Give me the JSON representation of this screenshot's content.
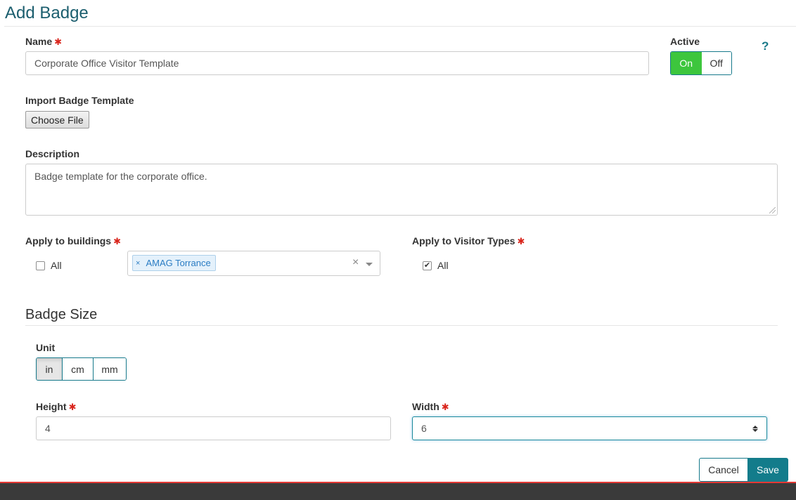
{
  "page": {
    "title": "Add Badge"
  },
  "name_field": {
    "label": "Name",
    "required_mark": "✱",
    "value": "Corporate Office Visitor Template"
  },
  "active": {
    "label": "Active",
    "on_label": "On",
    "off_label": "Off",
    "selected": "On"
  },
  "help": {
    "glyph": "?"
  },
  "import_template": {
    "label": "Import Badge Template",
    "button_label": "Choose File"
  },
  "description": {
    "label": "Description",
    "value": "Badge template for the corporate office."
  },
  "buildings": {
    "label": "Apply to buildings",
    "required_mark": "✱",
    "all_label": "All",
    "all_checked": false,
    "selected_tags": [
      {
        "remove": "×",
        "label": "AMAG Torrance"
      }
    ],
    "clear_glyph": "×"
  },
  "visitor_types": {
    "label": "Apply to Visitor Types",
    "required_mark": "✱",
    "all_label": "All",
    "all_checked": true
  },
  "badge_size": {
    "title": "Badge Size",
    "unit": {
      "label": "Unit",
      "options": [
        "in",
        "cm",
        "mm"
      ],
      "selected": "in"
    },
    "height": {
      "label": "Height",
      "required_mark": "✱",
      "value": "4"
    },
    "width": {
      "label": "Width",
      "required_mark": "✱",
      "value": "6"
    }
  },
  "actions": {
    "cancel_label": "Cancel",
    "save_label": "Save"
  },
  "colors": {
    "accent": "#137c8b",
    "toggle_on": "#3dc63d",
    "required": "#d9251c",
    "footer": "#3a3a3a",
    "footer_stripe": "#e53935"
  },
  "icons": {
    "check": "✔"
  }
}
